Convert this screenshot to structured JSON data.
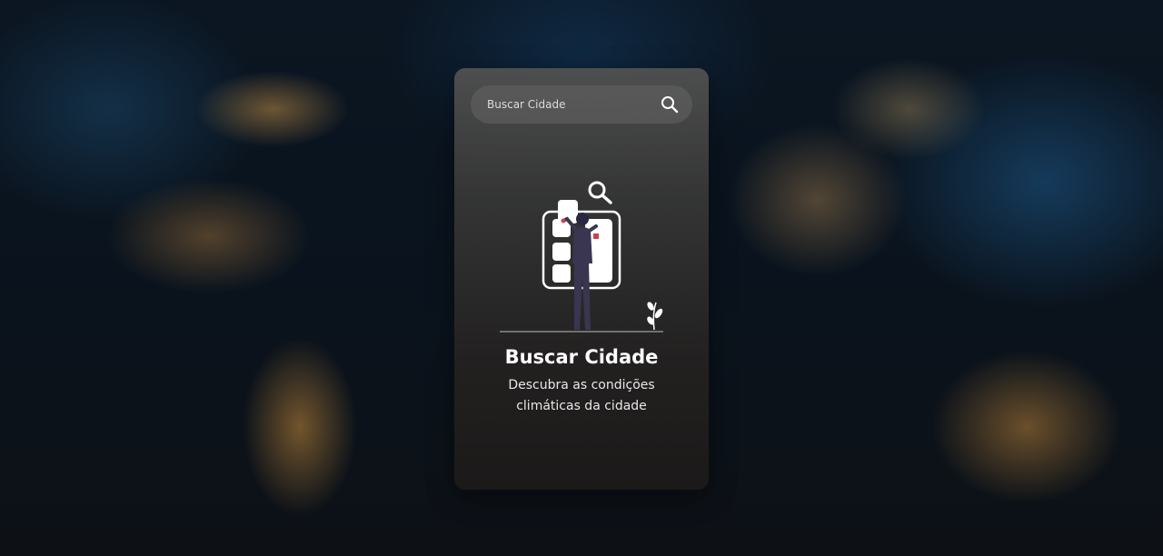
{
  "search": {
    "placeholder": "Buscar Cidade",
    "icon": "search-icon"
  },
  "empty_state": {
    "illustration": "person-checklist-search-illustration",
    "title": "Buscar Cidade",
    "description_line1": "Descubra as condições",
    "description_line2": "climáticas da cidade"
  },
  "colors": {
    "card_top": "#505050",
    "card_bottom": "#1c1a19",
    "accent_red": "#c4464a",
    "figure_dark": "#3a3550",
    "text": "#ffffff"
  }
}
